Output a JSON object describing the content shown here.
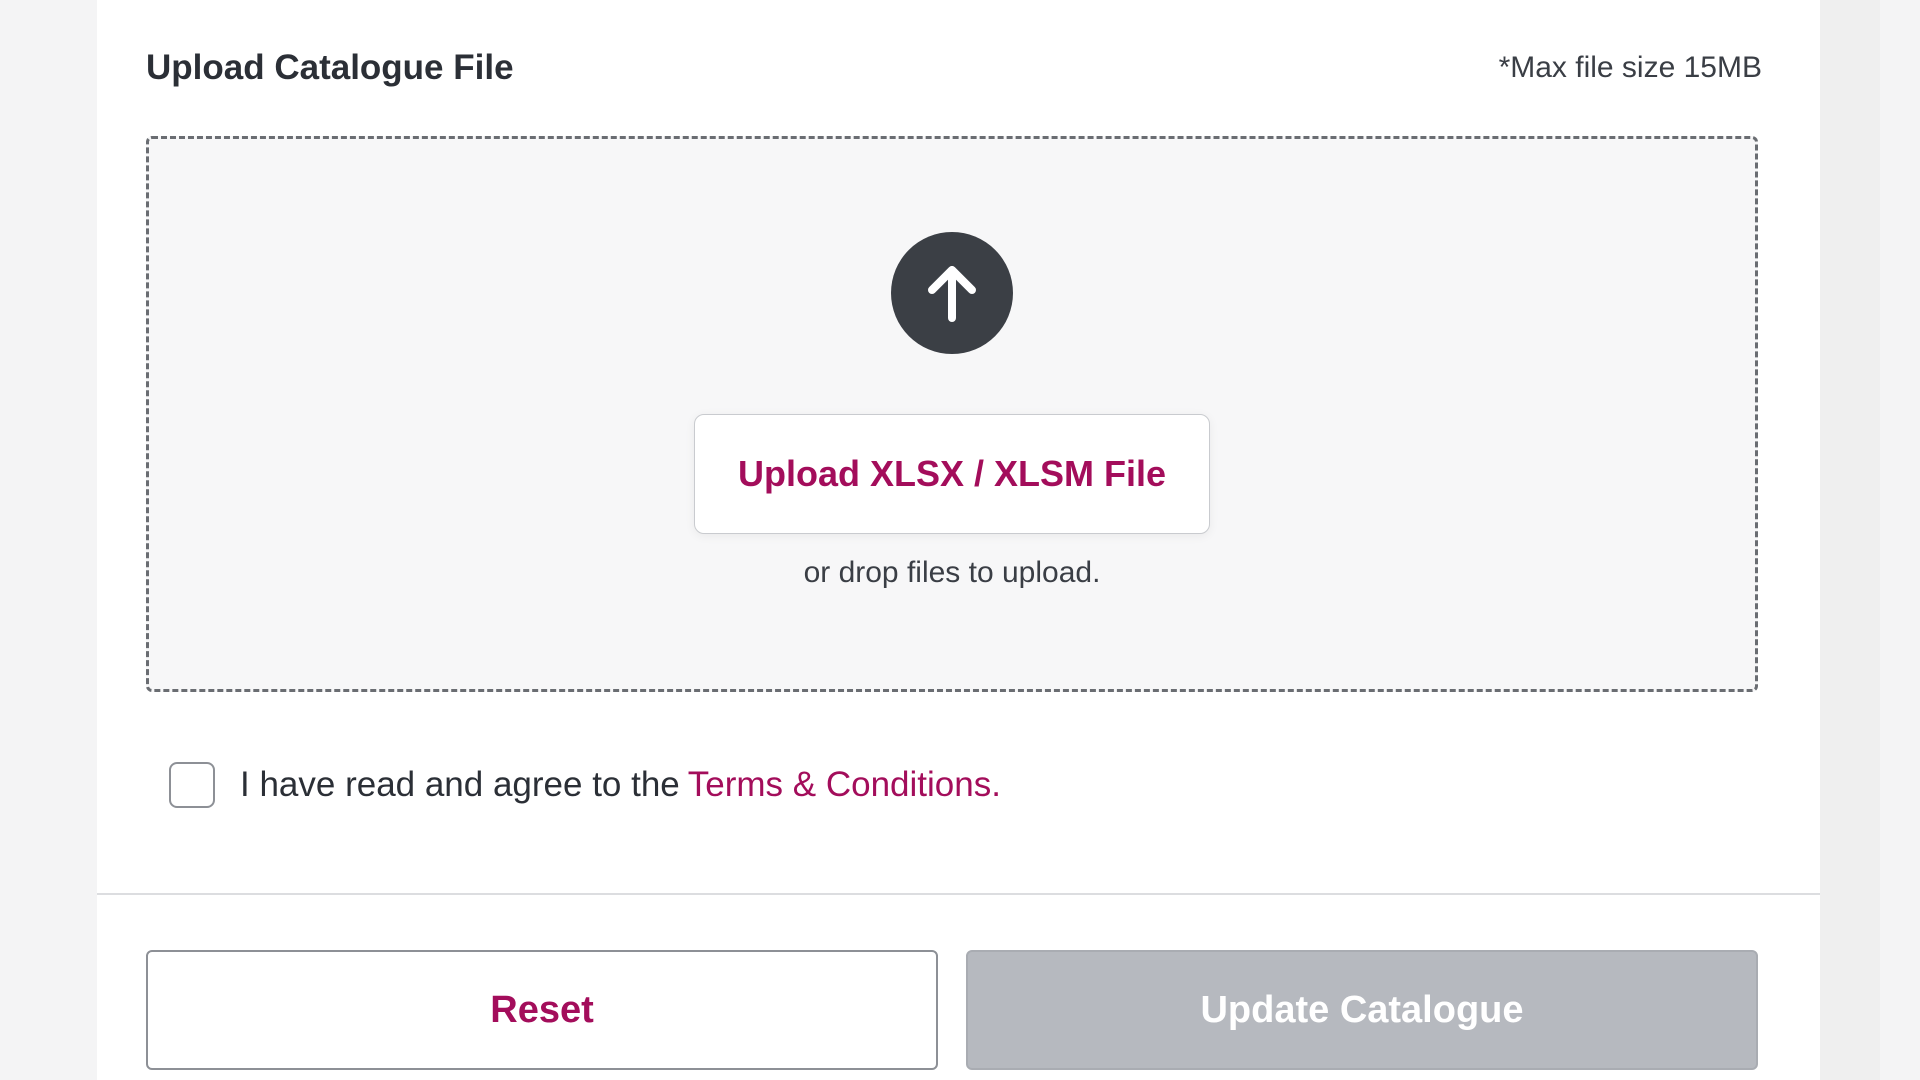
{
  "upload_section": {
    "title": "Upload Catalogue File",
    "max_size_note": "*Max file size 15MB",
    "upload_icon": "arrow-up-icon",
    "upload_button_label": "Upload XLSX / XLSM File",
    "drop_hint": "or drop files to upload."
  },
  "terms": {
    "text": "I have read and agree to the",
    "link_label": "Terms & Conditions.",
    "checked": false
  },
  "actions": {
    "reset_label": "Reset",
    "update_label": "Update Catalogue"
  },
  "colors": {
    "accent": "#a30d5b",
    "icon_bg": "#3b3f45",
    "disabled_button": "#b6b9bf"
  }
}
